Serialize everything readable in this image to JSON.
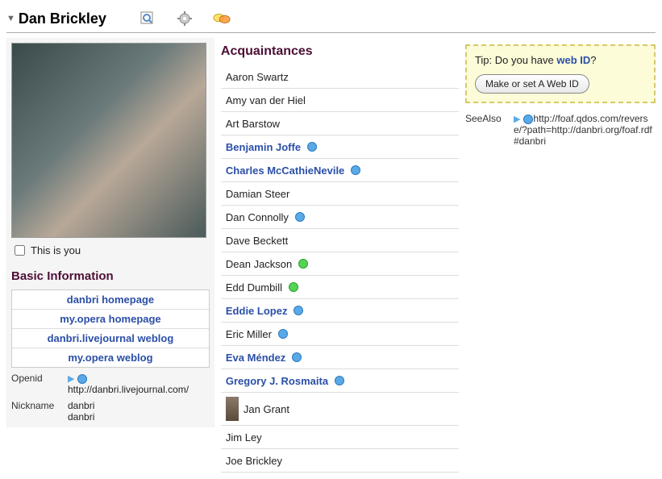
{
  "header": {
    "title": "Dan Brickley"
  },
  "left": {
    "this_is_you": "This is you",
    "section_title": "Basic Information",
    "links": [
      "danbri homepage",
      "my.opera homepage",
      "danbri.livejournal weblog",
      "my.opera weblog"
    ],
    "openid_label": "Openid",
    "openid_value": "http://danbri.livejournal.com/",
    "nickname_label": "Nickname",
    "nickname_value1": "danbri",
    "nickname_value2": "danbri"
  },
  "acquaintances": {
    "title": "Acquaintances",
    "items": [
      {
        "name": "Aaron Swartz",
        "link": false,
        "dot": null
      },
      {
        "name": "Amy van der Hiel",
        "link": false,
        "dot": null
      },
      {
        "name": "Art Barstow",
        "link": false,
        "dot": null
      },
      {
        "name": "Benjamin Joffe",
        "link": true,
        "dot": "blue"
      },
      {
        "name": "Charles McCathieNevile",
        "link": true,
        "dot": "blue"
      },
      {
        "name": " Damian Steer",
        "link": false,
        "dot": null
      },
      {
        "name": "Dan Connolly",
        "link": false,
        "dot": "blue"
      },
      {
        "name": "Dave Beckett",
        "link": false,
        "dot": null
      },
      {
        "name": "Dean Jackson",
        "link": false,
        "dot": "green"
      },
      {
        "name": "Edd Dumbill",
        "link": false,
        "dot": "green"
      },
      {
        "name": "Eddie Lopez",
        "link": true,
        "dot": "blue"
      },
      {
        "name": " Eric Miller",
        "link": false,
        "dot": "blue"
      },
      {
        "name": "Eva Méndez",
        "link": true,
        "dot": "blue"
      },
      {
        "name": "Gregory J. Rosmaita",
        "link": true,
        "dot": "blue"
      },
      {
        "name": "Jan Grant",
        "link": false,
        "dot": null,
        "thumb": true
      },
      {
        "name": "Jim Ley",
        "link": false,
        "dot": null
      },
      {
        "name": "Joe Brickley",
        "link": false,
        "dot": null
      }
    ]
  },
  "right": {
    "tip_prefix": "Tip: Do you have ",
    "tip_link": "web ID",
    "tip_suffix": "?",
    "button": "Make or set A Web ID",
    "seealso_label": "SeeAlso",
    "seealso_value": "http://foaf.qdos.com/reverse/?path=http://danbri.org/foaf.rdf#danbri"
  }
}
